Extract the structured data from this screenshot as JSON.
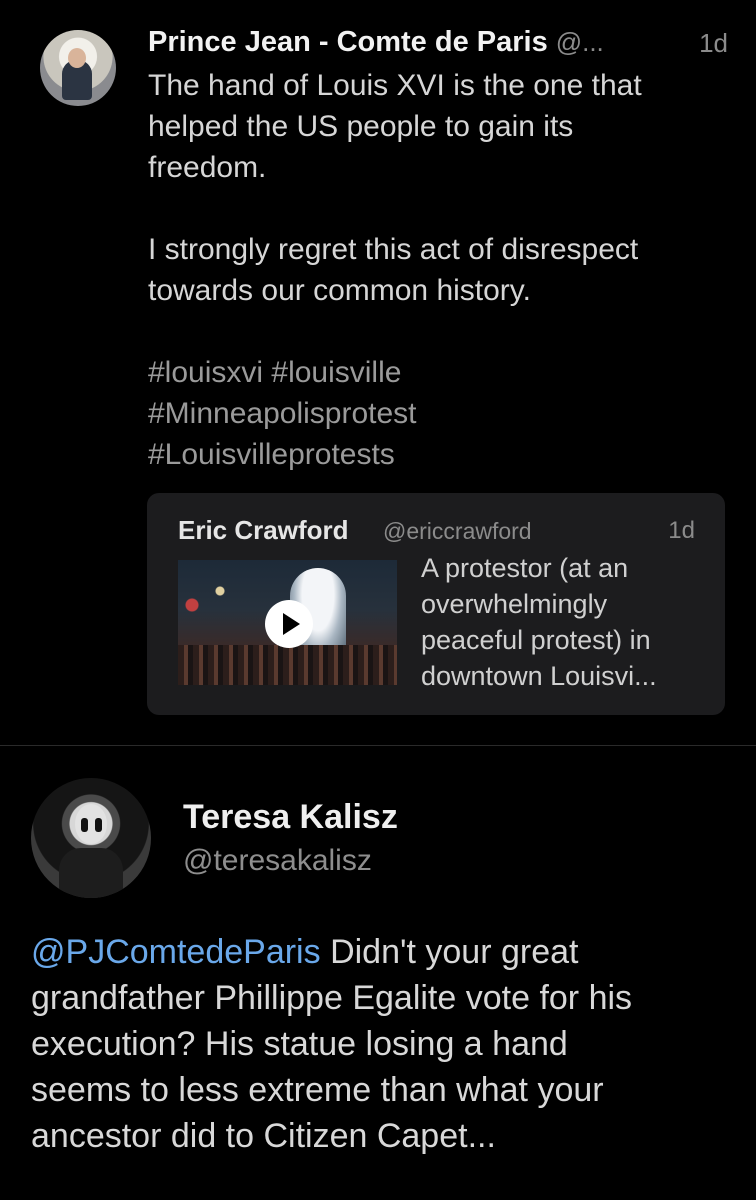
{
  "tweet1": {
    "author_name": "Prince Jean - Comte de Paris",
    "author_handle": "@...",
    "time": "1d",
    "lines_part1": [
      "The hand of Louis XVI is the one that",
      "helped the US people to gain its",
      "freedom."
    ],
    "lines_part2": [
      "I strongly regret this act of disrespect",
      "towards our common history."
    ],
    "hashtag_lines": [
      "#louisxvi #louisville",
      "#Minneapolisprotest",
      "#Louisvilleprotests"
    ],
    "quote": {
      "author_name": "Eric Crawford",
      "author_handle": "@ericcrawford",
      "time": "1d",
      "lines": [
        "A protestor (at an",
        "overwhelmingly",
        "peaceful protest) in",
        "downtown Louisvi..."
      ],
      "media": "video-thumbnail"
    }
  },
  "tweet2": {
    "author_name": "Teresa Kalisz",
    "author_handle": "@teresakalisz",
    "mention": "@PJComtedeParis",
    "line1_rest": " Didn't your great",
    "lines": [
      "grandfather Phillippe Egalite vote for his",
      "execution? His statue losing a hand",
      "seems to less extreme than what your",
      "ancestor did to Citizen Capet..."
    ]
  },
  "icons": {
    "play": "play-icon"
  },
  "colors": {
    "background": "#000000",
    "mention": "#6aa8ea",
    "quote_card": "#1c1c1e"
  }
}
